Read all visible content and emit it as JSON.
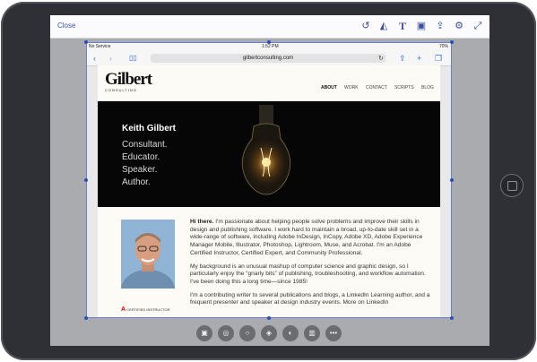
{
  "toolbar": {
    "close_label": "Close",
    "icons": [
      "undo-icon",
      "shape-icon",
      "text-icon",
      "image-icon",
      "share-icon",
      "settings-icon",
      "fullscreen-icon"
    ]
  },
  "browser": {
    "carrier": "No Service",
    "time": "1:52 PM",
    "battery": "70%",
    "url": "gilbertconsulting.com"
  },
  "site": {
    "logo_title": "Gilbert",
    "logo_subtitle": "CONSULTING",
    "menu": [
      "ABOUT",
      "WORK",
      "CONTACT",
      "SCRIPTS",
      "BLOG"
    ],
    "hero_name": "Keith Gilbert",
    "hero_lines": [
      "Consultant.",
      "Educator.",
      "Speaker.",
      "Author."
    ],
    "intro_bold": "Hi there.",
    "intro_text": " I'm passionate about helping people solve problems and improve their skills in design and publishing software. I work hard to maintain a broad, up-to-date skill set in a wide-range of software, including Adobe InDesign, InCopy, Adobe XD, Adobe Experience Manager Mobile, Illustrator, Photoshop, Lightroom, Muse, and Acrobat. I'm an Adobe Certified Instructor, Certified Expert, and Community Professional.",
    "para2": "My background is an unusual mashup of computer science and graphic design, so I particularly enjoy the “gnarly bits” of publishing, troubleshooting, and workflow automation. I've been doing this a long time—since 1985!",
    "para3": "I'm a contributing writer to several publications and blogs, a LinkedIn Learning author, and a frequent presenter and speaker at design industry events. More on LinkedIn",
    "badge": "CERTIFIED INSTRUCTOR"
  },
  "bottom_tools": [
    "image-icon",
    "camera-icon",
    "circle-icon",
    "layers-icon",
    "visibility-icon",
    "trash-icon",
    "more-icon"
  ],
  "colors": {
    "accent": "#3f51b5",
    "link": "#2a6fd8",
    "hero_bg": "#060606"
  }
}
